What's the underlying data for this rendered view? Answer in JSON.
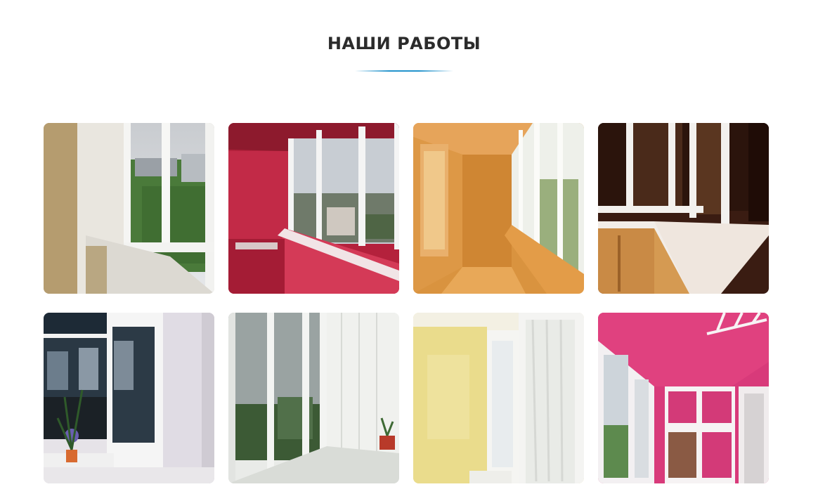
{
  "section": {
    "title": "НАШИ РАБОТЫ"
  },
  "gallery": {
    "accent_color": "#2393cc",
    "photos": [
      {
        "subject": "white-windows-beige-walls"
      },
      {
        "subject": "red-walls-white-windows"
      },
      {
        "subject": "wood-paneled-balcony"
      },
      {
        "subject": "white-counter-wood-cabinets"
      },
      {
        "subject": "balcony-door-with-plant"
      },
      {
        "subject": "white-panel-balcony"
      },
      {
        "subject": "yellow-walls-curtain-window"
      },
      {
        "subject": "pink-balcony-wardrobe"
      }
    ]
  }
}
